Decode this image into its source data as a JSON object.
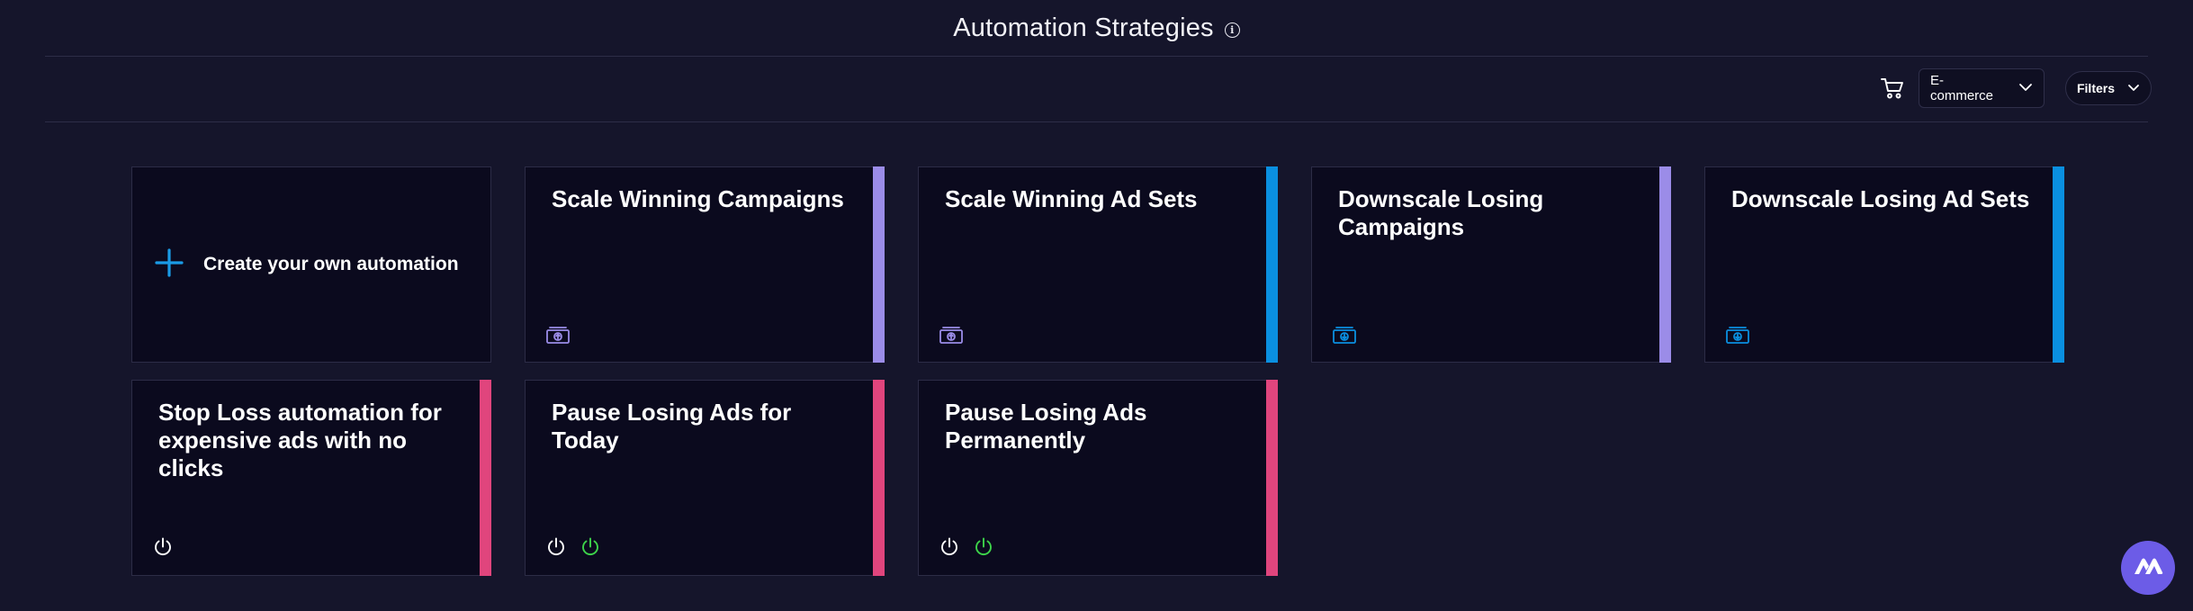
{
  "header": {
    "title": "Automation Strategies"
  },
  "toolbar": {
    "cart_icon": "shopping-cart-icon",
    "category_select": {
      "value": "E-commerce"
    },
    "filters_label": "Filters"
  },
  "create_card": {
    "label": "Create your own automation",
    "icon": "plus-icon"
  },
  "colors": {
    "lavender": "#9b8ce8",
    "blue": "#0a8fe0",
    "pink": "#e0457d",
    "green": "#3dd44a",
    "fab": "#6c5ce7"
  },
  "cards": [
    {
      "title": "Scale Winning Campaigns",
      "accent": "lavender",
      "icons": [
        "money-up-icon"
      ]
    },
    {
      "title": "Scale Winning Ad Sets",
      "accent": "blue",
      "icons": [
        "money-up-icon"
      ]
    },
    {
      "title": "Downscale Losing Campaigns",
      "accent": "lavender",
      "icons": [
        "money-down-icon"
      ]
    },
    {
      "title": "Downscale Losing Ad Sets",
      "accent": "blue",
      "icons": [
        "money-down-icon"
      ]
    },
    {
      "title": "Stop Loss automation for expensive ads with no clicks",
      "accent": "pink",
      "icons": [
        "power-icon"
      ]
    },
    {
      "title": "Pause Losing Ads for Today",
      "accent": "pink",
      "icons": [
        "power-icon",
        "power-on-icon"
      ]
    },
    {
      "title": "Pause Losing Ads Permanently",
      "accent": "pink",
      "icons": [
        "power-icon",
        "power-on-icon"
      ]
    }
  ]
}
